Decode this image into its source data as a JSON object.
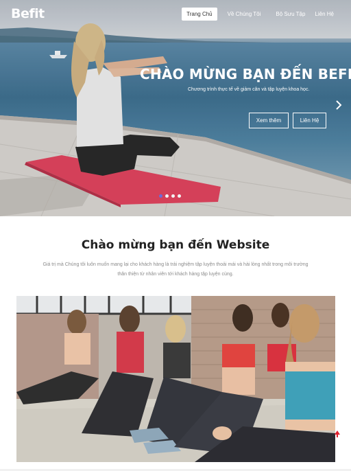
{
  "brand": {
    "logo": "Befit"
  },
  "nav": {
    "items": [
      {
        "label": "Trang Chủ",
        "active": true
      },
      {
        "label": "Về Chúng Tôi",
        "active": false
      },
      {
        "label": "Bộ Sưu Tập",
        "active": false
      },
      {
        "label": "Liên Hệ",
        "active": false
      }
    ]
  },
  "hero": {
    "title": "CHÀO MỪNG BẠN ĐẾN BEFIT",
    "subtitle": "Chương trình thực tế về giảm cân và tập luyện khoa học.",
    "primary_button": "Xem thêm",
    "secondary_button": "Liên Hệ",
    "next_icon": "chevron-right-icon",
    "slides": {
      "count": 4,
      "active_index": 0
    }
  },
  "welcome": {
    "title": "Chào mừng bạn đến Website",
    "description_line1": "Giá trị mà Chúng tôi luôn muốn mang lại cho khách hàng là trải nghiệm tập luyện thoải mái và hài lòng nhất trong môi trường",
    "description_line2": "thân thiện từ nhân viên tới khách hàng tập luyện cùng."
  },
  "scroll_top_icon": "arrow-up-icon",
  "colors": {
    "accent": "#6b6bd8",
    "scroll_top": "#e0212f",
    "heading": "#222222",
    "muted_text": "#8a8a8a"
  }
}
